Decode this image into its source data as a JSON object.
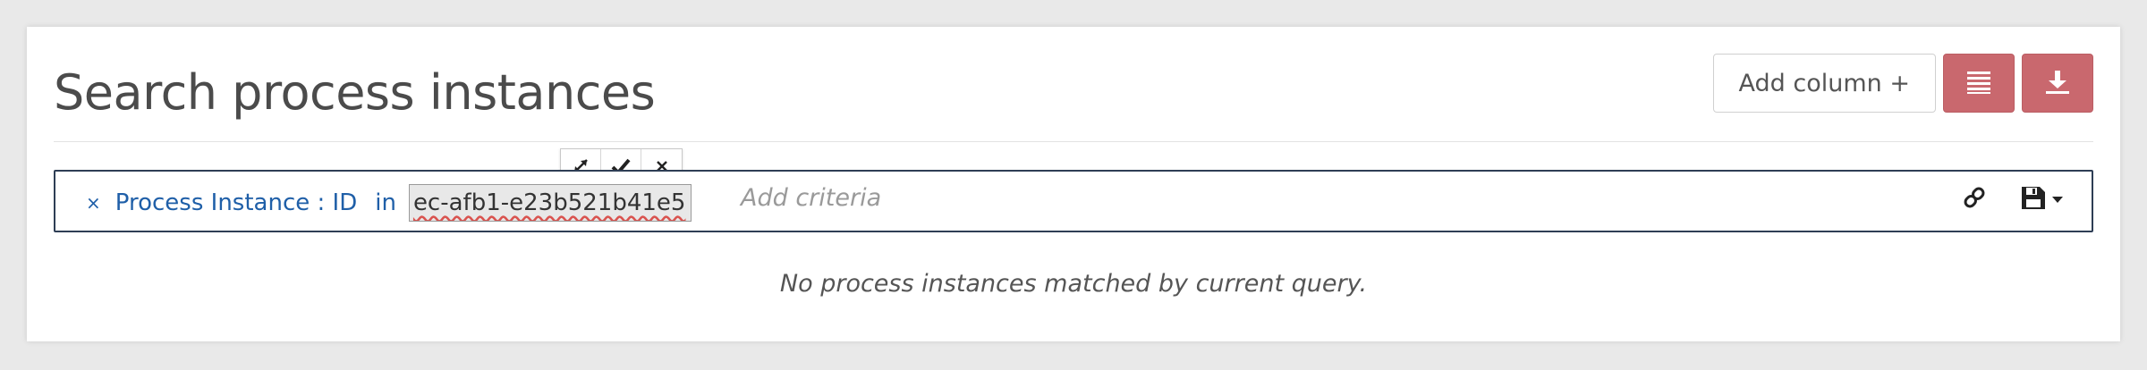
{
  "header": {
    "title": "Search process instances",
    "add_column_label": "Add column +",
    "list_icon": "list-icon",
    "download_icon": "download-icon",
    "accent_color": "#c9686e"
  },
  "search": {
    "criterion": {
      "remove_symbol": "×",
      "key": "Process Instance : ID",
      "operator": "in",
      "value": "ec-afb1-e23b521b41e5"
    },
    "edit_tools": [
      "expand-icon",
      "check-icon",
      "close-icon"
    ],
    "placeholder": "Add criteria",
    "link_icon": "link-icon",
    "save_icon": "save-icon"
  },
  "results": {
    "empty_message": "No process instances matched by current query."
  }
}
